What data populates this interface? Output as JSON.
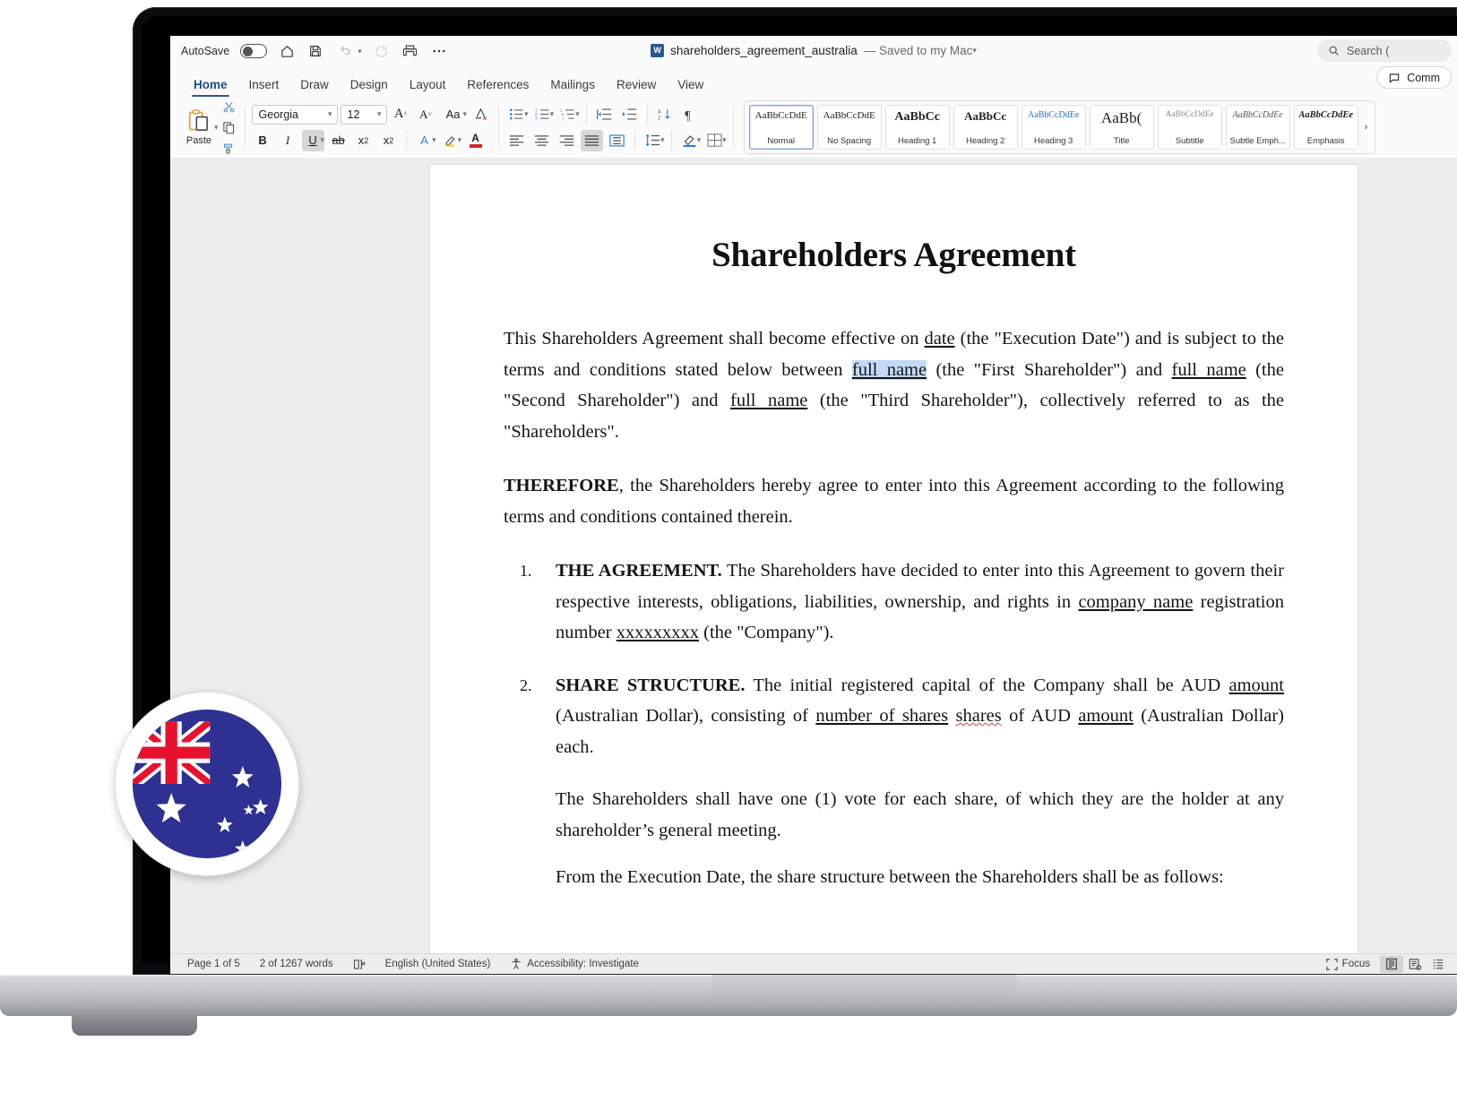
{
  "titlebar": {
    "autosave_label": "AutoSave",
    "autosave_state": "off",
    "doc_title": "shareholders_agreement_australia",
    "saved_state": "— Saved to my Mac",
    "search_placeholder": "Search (",
    "comments_label": "Comm",
    "icons": [
      "home-icon",
      "save-icon",
      "undo-icon",
      "redo-icon",
      "print-icon",
      "more-icon"
    ]
  },
  "tabs": [
    {
      "label": "Home",
      "active": true
    },
    {
      "label": "Insert",
      "active": false
    },
    {
      "label": "Draw",
      "active": false
    },
    {
      "label": "Design",
      "active": false
    },
    {
      "label": "Layout",
      "active": false
    },
    {
      "label": "References",
      "active": false
    },
    {
      "label": "Mailings",
      "active": false
    },
    {
      "label": "Review",
      "active": false
    },
    {
      "label": "View",
      "active": false
    }
  ],
  "ribbon": {
    "clipboard": {
      "paste_label": "Paste",
      "cut_name": "cut-icon",
      "copy_name": "copy-icon",
      "format_painter_name": "format-painter-icon"
    },
    "font": {
      "font_name": "Georgia",
      "font_size": "12",
      "grow_label": "A",
      "shrink_label": "A",
      "change_case_label": "Aa",
      "clear_format_label": "A",
      "bold_label": "B",
      "italic_label": "I",
      "underline_label": "U",
      "underline_active": true,
      "strikethrough_label": "ab",
      "subscript_label": "x",
      "superscript_label": "x",
      "text_effects_label": "A",
      "highlight_label": "A",
      "font_color_label": "A"
    },
    "paragraph": {
      "bullets_name": "bullet-list-icon",
      "numbering_name": "numbered-list-icon",
      "multilevel_name": "multilevel-list-icon",
      "decrease_indent_name": "decrease-indent-icon",
      "increase_indent_name": "increase-indent-icon",
      "sort_name": "sort-icon",
      "show_marks_name": "paragraph-marks-icon",
      "align_left_name": "align-left-icon",
      "align_center_name": "align-center-icon",
      "align_right_name": "align-right-icon",
      "justify_name": "justify-icon",
      "justify_active": true,
      "distributed_name": "distributed-icon",
      "line_spacing_name": "line-spacing-icon",
      "shading_name": "shading-icon",
      "borders_name": "borders-icon"
    },
    "styles": [
      {
        "preview": "AaBbCcDdE",
        "name": "Normal",
        "selected": true,
        "cls": "sp-n"
      },
      {
        "preview": "AaBbCcDdE",
        "name": "No Spacing",
        "selected": false,
        "cls": "sp-n"
      },
      {
        "preview": "AaBbCc",
        "name": "Heading 1",
        "selected": false,
        "cls": "sp-h1"
      },
      {
        "preview": "AaBbCc",
        "name": "Heading 2",
        "selected": false,
        "cls": "sp-h2"
      },
      {
        "preview": "AaBbCcDdEe",
        "name": "Heading 3",
        "selected": false,
        "cls": "sp-h3"
      },
      {
        "preview": "AaBb(",
        "name": "Title",
        "selected": false,
        "cls": "sp-title"
      },
      {
        "preview": "AaBbCcDdEe",
        "name": "Subtitle",
        "selected": false,
        "cls": "sp-sub"
      },
      {
        "preview": "AaBbCcDdEe",
        "name": "Subtle Emph...",
        "selected": false,
        "cls": "sp-em"
      },
      {
        "preview": "AaBbCcDdEe",
        "name": "Emphasis",
        "selected": false,
        "cls": "sp-em2"
      }
    ],
    "styles_more": "›"
  },
  "document": {
    "title": "Shareholders Agreement",
    "p1": {
      "a": "This Shareholders Agreement shall become effective on ",
      "date": "date",
      "b": " (the \"Execution Date\") and is subject to the terms and conditions stated below between ",
      "name1": "full name",
      "c": " (the \"First Shareholder\") and ",
      "name2": "full name",
      "d": " (the \"Second Shareholder\") and ",
      "name3": "full name",
      "e": " (the \"Third Shareholder\"), collectively referred to as the \"Shareholders\"."
    },
    "p2": {
      "bold": "THEREFORE",
      "rest": ", the Shareholders hereby agree to enter into this Agreement according to the following terms and conditions contained therein."
    },
    "item1": {
      "num": "1.",
      "heading": "THE AGREEMENT.",
      "a": " The Shareholders have decided to enter into this Agreement to govern their respective interests, obligations, liabilities, ownership, and rights in ",
      "company": "company name",
      "b": " registration number ",
      "regnum": "xxxxxxxxx",
      "c": " (the \"Company\")."
    },
    "item2": {
      "num": "2.",
      "heading": "SHARE STRUCTURE.",
      "a": " The initial registered capital of the Company shall be AUD ",
      "amount1": "amount",
      "b": " (Australian Dollar), consisting of ",
      "shares_num": "number of shares",
      "c": " ",
      "shares_word": "shares",
      "d": " of AUD ",
      "amount2": "amount",
      "e": " (Australian Dollar) each."
    },
    "item2_p2": "The Shareholders shall have one (1) vote for each share, of which they are the holder at any shareholder’s general meeting.",
    "item2_p3": "From the Execution Date, the share structure between the Shareholders shall be as follows:"
  },
  "statusbar": {
    "page": "Page 1 of 5",
    "words": "2 of 1267 words",
    "proofing_name": "proofing-icon",
    "language": "English (United States)",
    "accessibility": "Accessibility: Investigate",
    "focus": "Focus",
    "view_print_name": "print-layout-icon",
    "view_web_name": "web-layout-icon",
    "view_outline_name": "outline-view-icon"
  },
  "badge": {
    "name": "australia-flag-badge",
    "colors": {
      "navy": "#2e3192",
      "red": "#e8112d",
      "white": "#ffffff"
    }
  },
  "theme": {
    "accent": "#2b579a",
    "selection": "#c3d9f5",
    "spell_error": "#e03b3b"
  }
}
